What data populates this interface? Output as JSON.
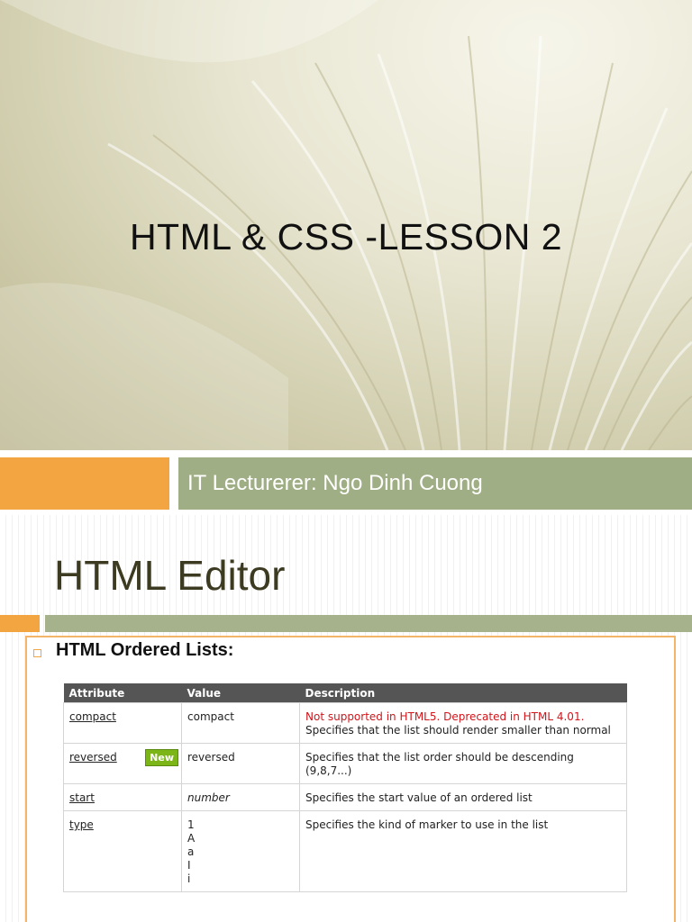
{
  "slide1": {
    "title": "HTML & CSS -LESSON 2",
    "lecturer": "IT Lecturerer: Ngo Dinh Cuong"
  },
  "slide2": {
    "title": "HTML Editor",
    "bullet_heading": "HTML Ordered Lists:",
    "table": {
      "headers": [
        "Attribute",
        "Value",
        "Description"
      ],
      "rows": [
        {
          "attribute": "compact",
          "value": "compact",
          "description_warning": "Not supported in HTML5. Deprecated in HTML 4.01.",
          "description": " Specifies that the list should render smaller than normal"
        },
        {
          "attribute": "reversed",
          "badge": "New",
          "value": "reversed",
          "description": "Specifies that the list order should be descending (9,8,7...)"
        },
        {
          "attribute": "start",
          "value": "number",
          "description": "Specifies the start value of an ordered list"
        },
        {
          "attribute": "type",
          "values": [
            "1",
            "A",
            "a",
            "I",
            "i"
          ],
          "description": "Specifies the kind of marker to use in the list"
        }
      ]
    }
  },
  "colors": {
    "accent_orange": "#f2a540",
    "accent_green": "#9fae84",
    "warning_red": "#d0161b",
    "badge_green": "#7cb518"
  }
}
